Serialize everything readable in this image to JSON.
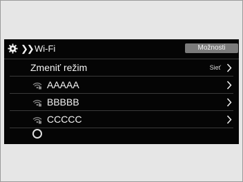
{
  "header": {
    "settings_icon": "gear-icon",
    "breadcrumb_icon": "double-chevron-right-icon",
    "title": "Wi-Fi",
    "options_label": "Možnosti"
  },
  "menu": {
    "mode_row": {
      "label": "Zmeniť režim",
      "value": "Sieť"
    },
    "networks": [
      {
        "ssid": "AAAAA",
        "icon": "wifi-lock-icon"
      },
      {
        "ssid": "BBBBB",
        "icon": "wifi-lock-icon"
      },
      {
        "ssid": "CCCCC",
        "icon": "wifi-lock-icon"
      }
    ],
    "loading_icon": "spinner-icon"
  },
  "colors": {
    "screen_background": "#050505",
    "options_button": "#7b7b7b",
    "page_background": "#e6e6e6"
  }
}
